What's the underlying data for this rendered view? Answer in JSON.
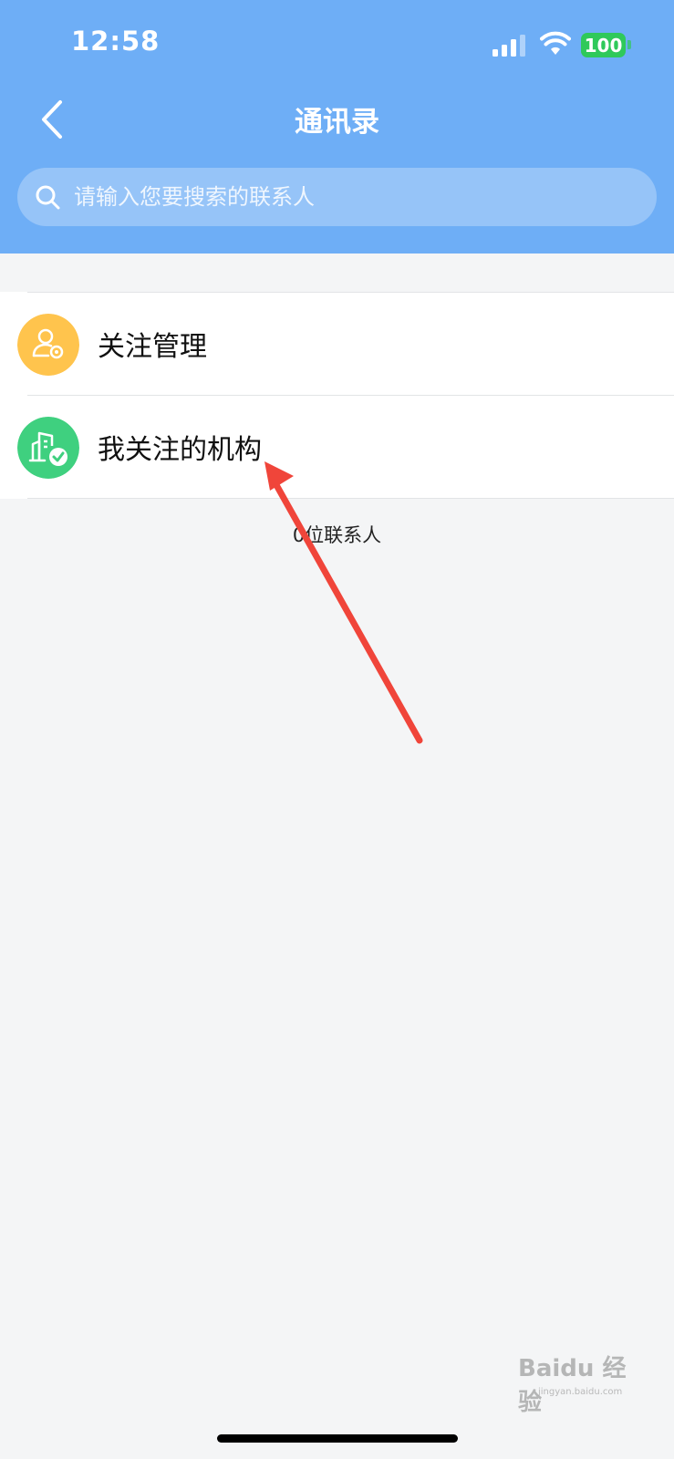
{
  "status_bar": {
    "time": "12:58",
    "battery": "100"
  },
  "header": {
    "title": "通讯录"
  },
  "search": {
    "placeholder": "请输入您要搜索的联系人"
  },
  "list": {
    "items": [
      {
        "label": "关注管理",
        "icon": "user-gear-icon",
        "color": "#ffc44d"
      },
      {
        "label": "我关注的机构",
        "icon": "building-check-icon",
        "color": "#3fd07f"
      }
    ]
  },
  "contact_count": "0位联系人",
  "watermark": {
    "brand": "Baidu 经验",
    "url": "jingyan.baidu.com"
  },
  "colors": {
    "header": "#6eaef6",
    "annotation_arrow": "#f0453a"
  }
}
